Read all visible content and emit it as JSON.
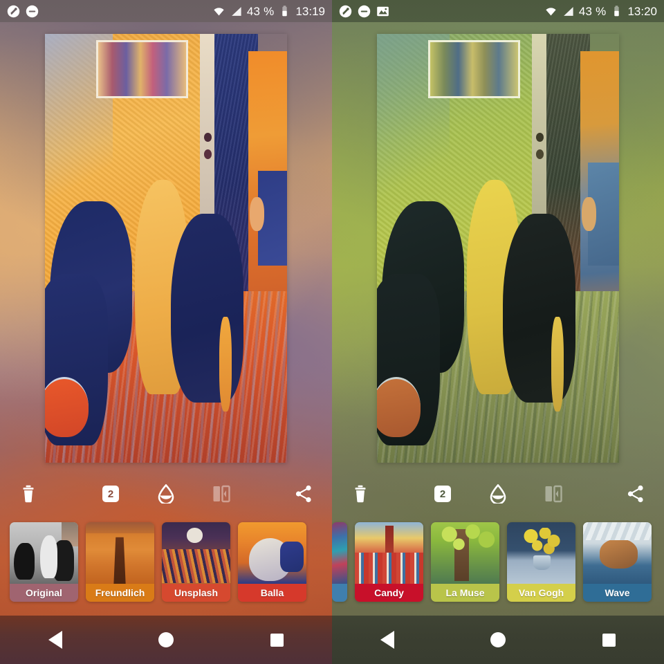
{
  "app": {
    "name": "style-transfer-photo-editor",
    "panels": [
      {
        "id": "left",
        "status_bar": {
          "icons": [
            "app-magic-wand-icon",
            "do-not-disturb-icon"
          ],
          "wifi_icon": "wifi-icon",
          "signal_icon": "cellular-signal-icon",
          "battery_percent": "43 %",
          "battery_icon": "battery-half-icon",
          "time": "13:19"
        },
        "toolbar": {
          "delete_label": "delete",
          "quality_badge": "2",
          "opacity_label": "opacity",
          "compare_label": "compare",
          "share_label": "share"
        },
        "filmstrip": [
          {
            "label": "Original",
            "label_color": "#a06470",
            "art": "th-original"
          },
          {
            "label": "Freundlich",
            "label_color": "#d97b17",
            "art": "th-freundlich"
          },
          {
            "label": "Unsplash",
            "label_color": "#d6492f",
            "art": "th-unsplash"
          },
          {
            "label": "Balla",
            "label_color": "#d6392b",
            "art": "th-balla"
          }
        ],
        "nav_bar": {
          "back": "back",
          "home": "home",
          "recents": "recents"
        },
        "accent_color": "#c45c32"
      },
      {
        "id": "right",
        "status_bar": {
          "icons": [
            "app-magic-wand-icon",
            "do-not-disturb-icon",
            "image-icon"
          ],
          "wifi_icon": "wifi-icon",
          "signal_icon": "cellular-signal-icon",
          "battery_percent": "43 %",
          "battery_icon": "battery-half-icon",
          "time": "13:20"
        },
        "toolbar": {
          "delete_label": "delete",
          "quality_badge": "2",
          "opacity_label": "opacity",
          "compare_label": "compare",
          "share_label": "share"
        },
        "filmstrip": [
          {
            "label": "",
            "label_color": "#3f7fae",
            "art": "th-sliverart"
          },
          {
            "label": "Candy",
            "label_color": "#c8102a",
            "art": "th-candy"
          },
          {
            "label": "La Muse",
            "label_color": "#b9c44a",
            "art": "th-lamuse"
          },
          {
            "label": "Van Gogh",
            "label_color": "#d4cf4a",
            "art": "th-vangogh"
          },
          {
            "label": "Wave",
            "label_color": "#2f6d96",
            "art": "th-wave"
          }
        ],
        "nav_bar": {
          "back": "back",
          "home": "home",
          "recents": "recents"
        },
        "accent_color": "#8a9a50"
      }
    ]
  }
}
